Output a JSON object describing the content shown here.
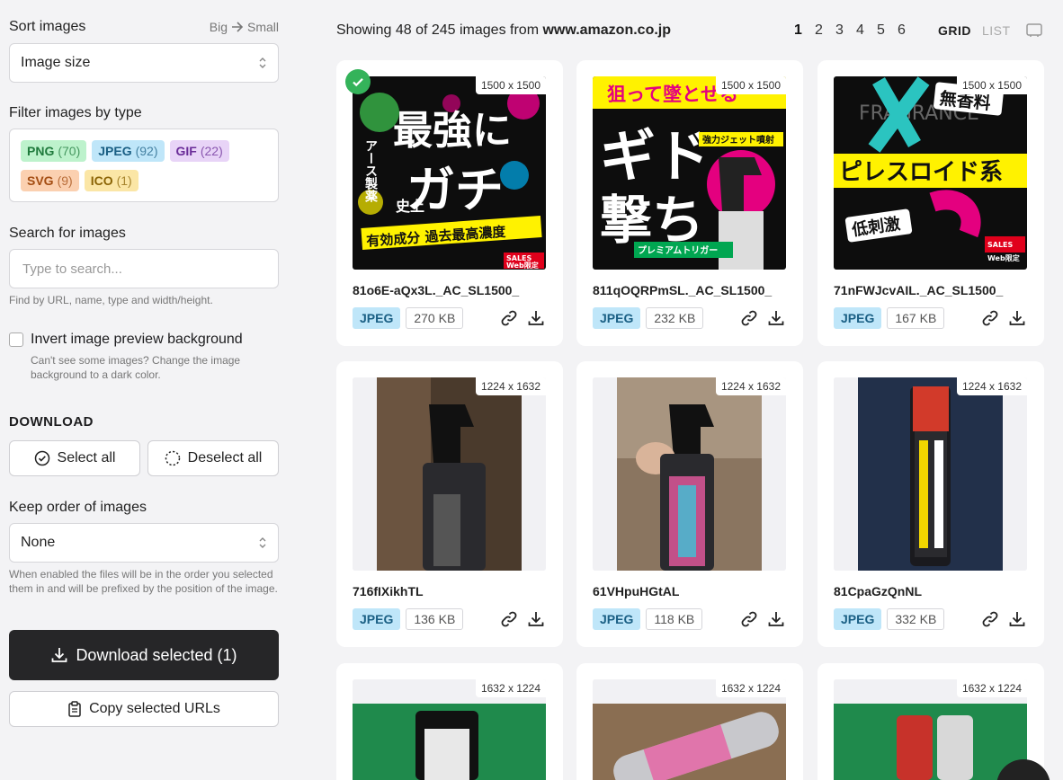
{
  "sidebar": {
    "sort": {
      "title": "Sort images",
      "hint_from": "Big",
      "hint_to": "Small",
      "value": "Image size"
    },
    "filter": {
      "title": "Filter images by type",
      "chips": [
        {
          "label": "PNG",
          "count": "(70)"
        },
        {
          "label": "JPEG",
          "count": "(92)"
        },
        {
          "label": "GIF",
          "count": "(22)"
        },
        {
          "label": "SVG",
          "count": "(9)"
        },
        {
          "label": "ICO",
          "count": "(1)"
        }
      ]
    },
    "search": {
      "title": "Search for images",
      "placeholder": "Type to search...",
      "help": "Find by URL, name, type and width/height."
    },
    "invert": {
      "label": "Invert image preview background",
      "help": "Can't see some images? Change the image background to a dark color."
    },
    "download": {
      "title": "DOWNLOAD",
      "select_all": "Select all",
      "deselect_all": "Deselect all"
    },
    "order": {
      "title": "Keep order of images",
      "value": "None",
      "help": "When enabled the files will be in the order you selected them in and will be prefixed by the position of the image."
    },
    "download_selected": "Download selected (1)",
    "copy_urls": "Copy selected URLs"
  },
  "header": {
    "showing_prefix": "Showing 48 of 245 images from",
    "domain": "www.amazon.co.jp",
    "pages": [
      "1",
      "2",
      "3",
      "4",
      "5",
      "6"
    ],
    "view_grid": "GRID",
    "view_list": "LIST"
  },
  "cards": [
    {
      "dims": "1500 x 1500",
      "name": "81o6E-aQx3L._AC_SL1500_",
      "type": "JPEG",
      "size": "270 KB"
    },
    {
      "dims": "1500 x 1500",
      "name": "811qOQRPmSL._AC_SL1500_",
      "type": "JPEG",
      "size": "232 KB"
    },
    {
      "dims": "1500 x 1500",
      "name": "71nFWJcvAIL._AC_SL1500_",
      "type": "JPEG",
      "size": "167 KB"
    },
    {
      "dims": "1224 x 1632",
      "name": "716fIXikhTL",
      "type": "JPEG",
      "size": "136 KB"
    },
    {
      "dims": "1224 x 1632",
      "name": "61VHpuHGtAL",
      "type": "JPEG",
      "size": "118 KB"
    },
    {
      "dims": "1224 x 1632",
      "name": "81CpaGzQnNL",
      "type": "JPEG",
      "size": "332 KB"
    },
    {
      "dims": "1632 x 1224"
    },
    {
      "dims": "1632 x 1224"
    },
    {
      "dims": "1632 x 1224"
    }
  ],
  "ad_text": {
    "a_main": "最強に",
    "a_main2": "ガチ",
    "a_side": "アース製薬",
    "a_side2": "史上",
    "a_band": "有効成分 過去最高濃度",
    "a_sales": "SALES",
    "a_web": "Web限定",
    "b_top": "狙って墜とせる",
    "b_main": "ギド",
    "b_main2": "撃ち",
    "b_tag": "強力ジェット噴射",
    "b_bottom": "プレミアムトリガー",
    "c_top": "FRAGRANCE",
    "c_badge": "無香料",
    "c_band": "ピレスロイド系",
    "c_low": "低刺激",
    "c_sales": "SALES",
    "c_web": "Web限定"
  },
  "colors": {
    "jpeg_bg": "#bfe6f9",
    "selected": "#34b35a",
    "dark_button": "#262628"
  }
}
